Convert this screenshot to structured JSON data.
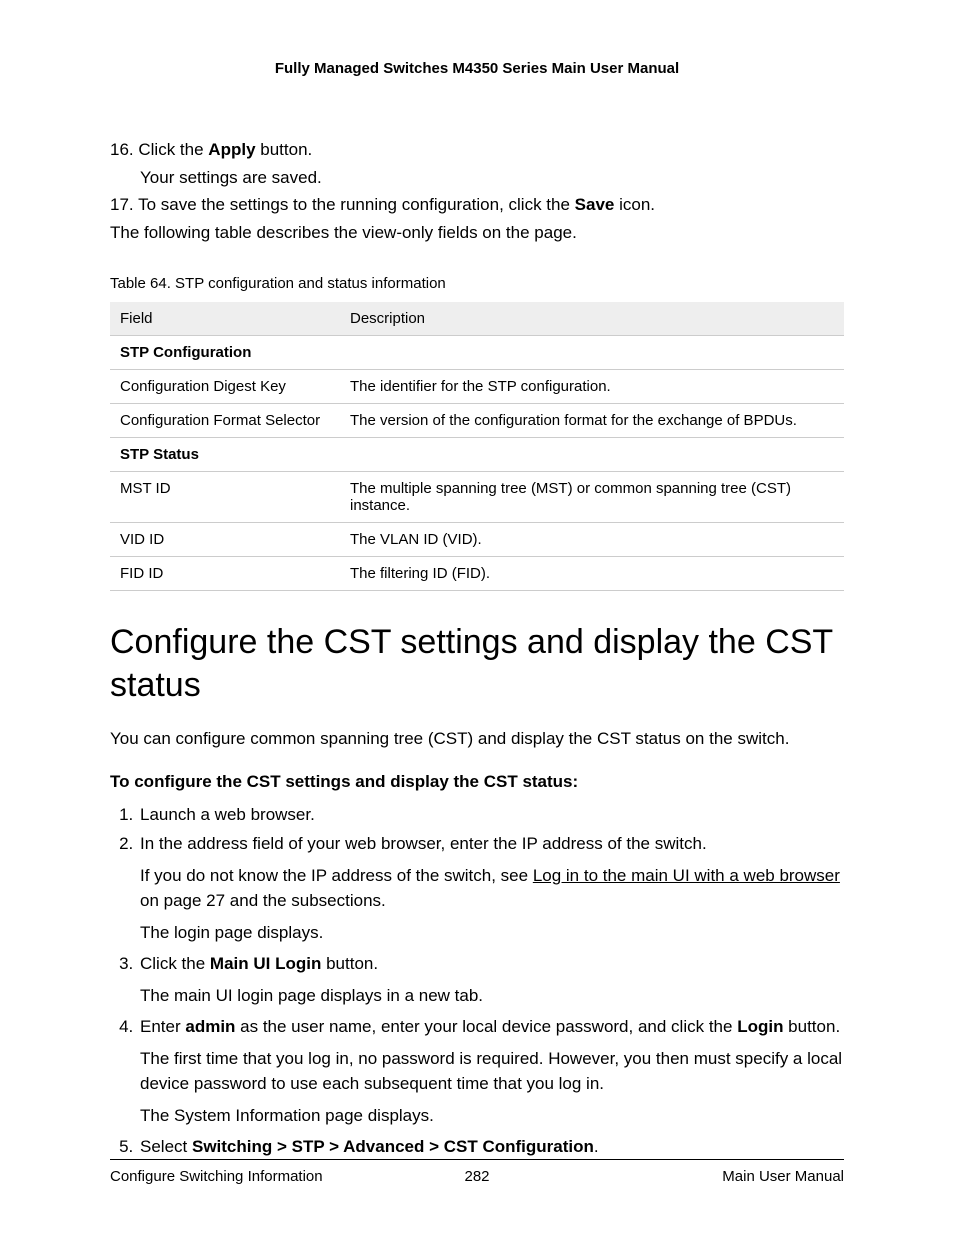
{
  "header": {
    "title": "Fully Managed Switches M4350 Series Main User Manual"
  },
  "pre_steps": {
    "s16_num": "16.",
    "s16_a": "Click the ",
    "s16_bold": "Apply",
    "s16_b": " button.",
    "s16_result": "Your settings are saved.",
    "s17_num": "17.",
    "s17_a": "To save the settings to the running configuration, click the ",
    "s17_bold": "Save",
    "s17_b": " icon.",
    "following": "The following table describes the view-only fields on the page."
  },
  "table": {
    "caption": "Table 64. STP configuration and status information",
    "head_field": "Field",
    "head_desc": "Description",
    "rows": [
      {
        "section": true,
        "field": "STP Configuration",
        "desc": ""
      },
      {
        "section": false,
        "field": "Configuration Digest Key",
        "desc": "The identifier for the STP configuration."
      },
      {
        "section": false,
        "field": "Configuration Format Selector",
        "desc": "The version of the configuration format for the exchange of BPDUs."
      },
      {
        "section": true,
        "field": "STP Status",
        "desc": ""
      },
      {
        "section": false,
        "field": "MST ID",
        "desc": "The multiple spanning tree (MST) or common spanning tree (CST) instance."
      },
      {
        "section": false,
        "field": "VID ID",
        "desc": "The VLAN ID (VID)."
      },
      {
        "section": false,
        "field": "FID ID",
        "desc": "The filtering ID (FID)."
      }
    ]
  },
  "heading": "Configure the CST settings and display the CST status",
  "intro": "You can configure common spanning tree (CST) and display the CST status on the switch.",
  "subheading": "To configure the CST settings and display the CST status:",
  "steps": {
    "s1": "Launch a web browser.",
    "s2": "In the address field of your web browser, enter the IP address of the switch.",
    "s2_p1_a": "If you do not know the IP address of the switch, see ",
    "s2_xref": "Log in to the main UI with a web browser",
    "s2_p1_b": " on page 27 and the subsections.",
    "s2_p2": "The login page displays.",
    "s3_a": "Click the ",
    "s3_bold": "Main UI Login",
    "s3_b": " button.",
    "s3_p": "The main UI login page displays in a new tab.",
    "s4_a": "Enter ",
    "s4_bold1": "admin",
    "s4_b": " as the user name, enter your local device password, and click the ",
    "s4_bold2": "Login",
    "s4_c": " button.",
    "s4_p1": "The first time that you log in, no password is required. However, you then must specify a local device password to use each subsequent time that you log in.",
    "s4_p2": "The System Information page displays.",
    "s5_a": "Select ",
    "s5_bold": "Switching > STP > Advanced > CST Configuration",
    "s5_b": "."
  },
  "footer": {
    "left": "Configure Switching Information",
    "center": "282",
    "right": "Main User Manual"
  }
}
